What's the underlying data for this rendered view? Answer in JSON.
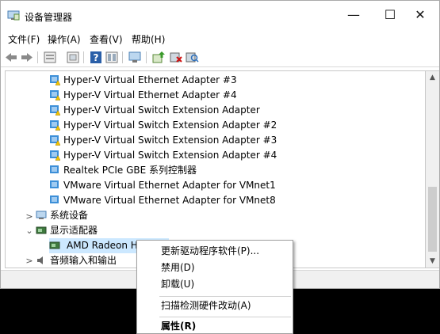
{
  "window": {
    "title": "设备管理器",
    "min_symbol": "—",
    "max_symbol": "☐",
    "close_symbol": "✕"
  },
  "menu": {
    "file": "文件(F)",
    "action": "操作(A)",
    "view": "查看(V)",
    "help": "帮助(H)"
  },
  "toolbar": {
    "icons": [
      "back-arrow-icon",
      "forward-arrow-icon",
      "properties-icon",
      "show-hidden-icon",
      "help-icon",
      "view-icon",
      "monitor-icon",
      "update-driver-icon",
      "uninstall-device-icon",
      "scan-hardware-icon"
    ]
  },
  "tree": {
    "adapters": [
      {
        "label": "Hyper-V Virtual Ethernet Adapter #3",
        "warning": true
      },
      {
        "label": "Hyper-V Virtual Ethernet Adapter #4",
        "warning": true
      },
      {
        "label": "Hyper-V Virtual Switch Extension Adapter",
        "warning": true
      },
      {
        "label": "Hyper-V Virtual Switch Extension Adapter #2",
        "warning": true
      },
      {
        "label": "Hyper-V Virtual Switch Extension Adapter #3",
        "warning": true
      },
      {
        "label": "Hyper-V Virtual Switch Extension Adapter #4",
        "warning": true
      },
      {
        "label": "Realtek PCIe GBE 系列控制器",
        "warning": false
      },
      {
        "label": "VMware Virtual Ethernet Adapter for VMnet1",
        "warning": false
      },
      {
        "label": "VMware Virtual Ethernet Adapter for VMnet8",
        "warning": false
      }
    ],
    "system_devices": "系统设备",
    "display_adapters": "显示适配器",
    "amd_device": "AMD Radeon HD",
    "audio": "音频输入和输出",
    "collapsed_symbol": ">",
    "expanded_symbol": "⌄"
  },
  "context_menu": {
    "update_driver": "更新驱动程序软件(P)...",
    "disable": "禁用(D)",
    "uninstall": "卸载(U)",
    "scan": "扫描检测硬件改动(A)",
    "properties": "属性(R)"
  },
  "colors": {
    "accent": "#2a6ebb",
    "warning": "#f2c200",
    "adapter_icon": "#3c8fd8"
  }
}
